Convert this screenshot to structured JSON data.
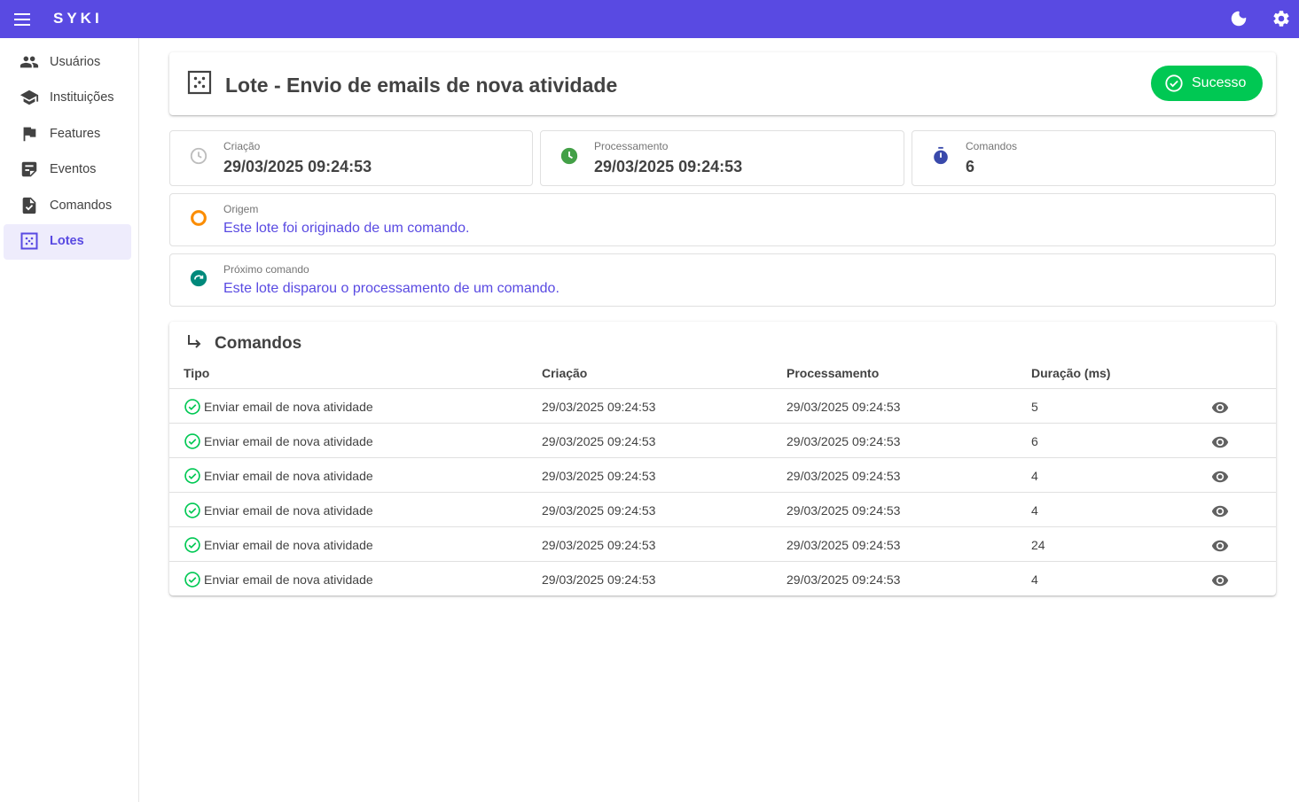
{
  "app": {
    "brand": "SYKI"
  },
  "colors": {
    "primary": "#594ae2",
    "success": "#00c853",
    "processing": "#43a047",
    "origin": "#fb8c00",
    "next": "#00897b",
    "commands": "#3949ab"
  },
  "appbar": {
    "icons": [
      "menu-icon",
      "dark-mode-icon",
      "settings-icon"
    ]
  },
  "sidebar": {
    "items": [
      {
        "label": "Usuários",
        "icon": "people-icon",
        "active": false
      },
      {
        "label": "Instituições",
        "icon": "school-icon",
        "active": false
      },
      {
        "label": "Features",
        "icon": "flag-icon",
        "active": false
      },
      {
        "label": "Eventos",
        "icon": "event-list-icon",
        "active": false
      },
      {
        "label": "Comandos",
        "icon": "task-file-icon",
        "active": false
      },
      {
        "label": "Lotes",
        "icon": "grid-dots-icon",
        "active": true
      }
    ]
  },
  "header": {
    "title": "Lote - Envio de emails de nova atividade",
    "status": "Sucesso"
  },
  "stats": {
    "creation": {
      "label": "Criação",
      "value": "29/03/2025 09:24:53"
    },
    "processing": {
      "label": "Processamento",
      "value": "29/03/2025 09:24:53"
    },
    "commands": {
      "label": "Comandos",
      "value": "6"
    }
  },
  "origin": {
    "label": "Origem",
    "text": "Este lote foi originado de um comando."
  },
  "next_command": {
    "label": "Próximo comando",
    "text": "Este lote disparou o processamento de um comando."
  },
  "commands_table": {
    "title": "Comandos",
    "headers": {
      "type": "Tipo",
      "created": "Criação",
      "processed": "Processamento",
      "duration": "Duração (ms)"
    },
    "rows": [
      {
        "type": "Enviar email de nova atividade",
        "created": "29/03/2025 09:24:53",
        "processed": "29/03/2025 09:24:53",
        "duration": "5"
      },
      {
        "type": "Enviar email de nova atividade",
        "created": "29/03/2025 09:24:53",
        "processed": "29/03/2025 09:24:53",
        "duration": "6"
      },
      {
        "type": "Enviar email de nova atividade",
        "created": "29/03/2025 09:24:53",
        "processed": "29/03/2025 09:24:53",
        "duration": "4"
      },
      {
        "type": "Enviar email de nova atividade",
        "created": "29/03/2025 09:24:53",
        "processed": "29/03/2025 09:24:53",
        "duration": "4"
      },
      {
        "type": "Enviar email de nova atividade",
        "created": "29/03/2025 09:24:53",
        "processed": "29/03/2025 09:24:53",
        "duration": "24"
      },
      {
        "type": "Enviar email de nova atividade",
        "created": "29/03/2025 09:24:53",
        "processed": "29/03/2025 09:24:53",
        "duration": "4"
      }
    ]
  }
}
